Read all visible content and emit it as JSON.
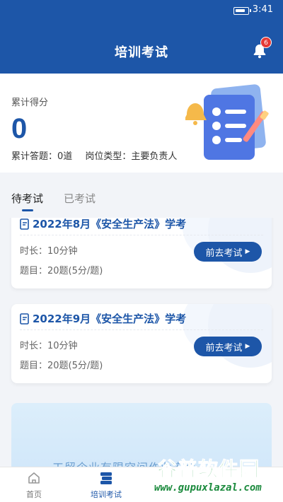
{
  "status": {
    "time": "3:41"
  },
  "header": {
    "title": "培训考试",
    "notification_count": "6"
  },
  "summary": {
    "score_label": "累计得分",
    "score": "0",
    "answered": "累计答题：0道",
    "position": "岗位类型：主要负责人"
  },
  "tabs": [
    {
      "label": "待考试",
      "active": true
    },
    {
      "label": "已考试",
      "active": false
    }
  ],
  "exams": [
    {
      "title": "2022年8月《安全生产法》学考",
      "duration": "时长：10分钟",
      "questions": "题目：20题(5分/题)",
      "button": "前去考试"
    },
    {
      "title": "2022年9月《安全生产法》学考",
      "duration": "时长：10分钟",
      "questions": "题目：20题(5分/题)",
      "button": "前去考试"
    }
  ],
  "banner": {
    "text": "工贸企业有限空间作业安全"
  },
  "bottom_nav": [
    {
      "label": "首页",
      "icon": "home-icon"
    },
    {
      "label": "培训考试",
      "icon": "book-stack-icon"
    }
  ],
  "watermark": {
    "name": "谷普软件园",
    "url": "www.gupuxlazal.com"
  },
  "colors": {
    "primary": "#1d56a8",
    "badge": "#e53935",
    "watermark": "#2aa84a"
  }
}
